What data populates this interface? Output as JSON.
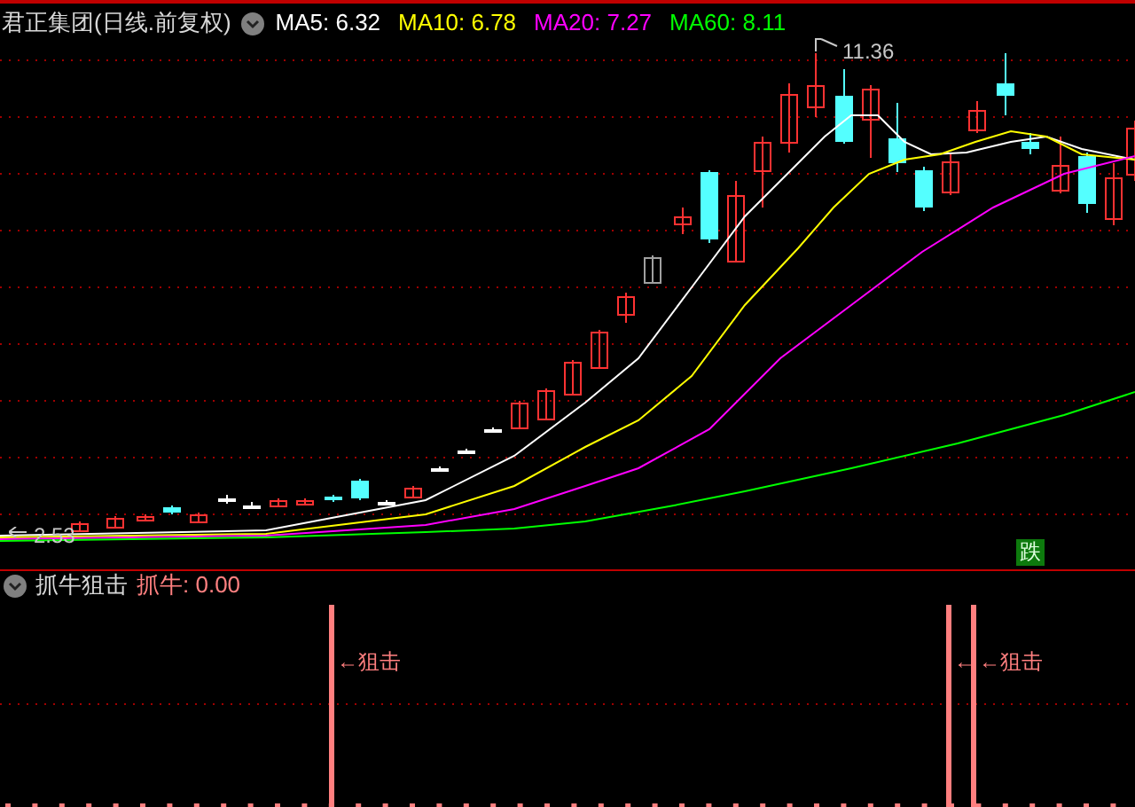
{
  "header": {
    "title": "君正集团(日线.前复权)",
    "ma": [
      {
        "label": "MA5: 6.32",
        "color": "#ffffff"
      },
      {
        "label": "MA10: 6.78",
        "color": "#ffff00"
      },
      {
        "label": "MA20: 7.27",
        "color": "#ff00ff"
      },
      {
        "label": "MA60: 8.11",
        "color": "#00ff00"
      }
    ]
  },
  "price_chart": {
    "high_label": "11.36",
    "low_label": "2.53",
    "signal_badge": "跌"
  },
  "indicator": {
    "name": "抓牛狙击",
    "reading": "抓牛: 0.00",
    "signals": [
      {
        "label": "←狙击"
      },
      {
        "label": "←"
      },
      {
        "label": "←狙击"
      }
    ]
  }
}
